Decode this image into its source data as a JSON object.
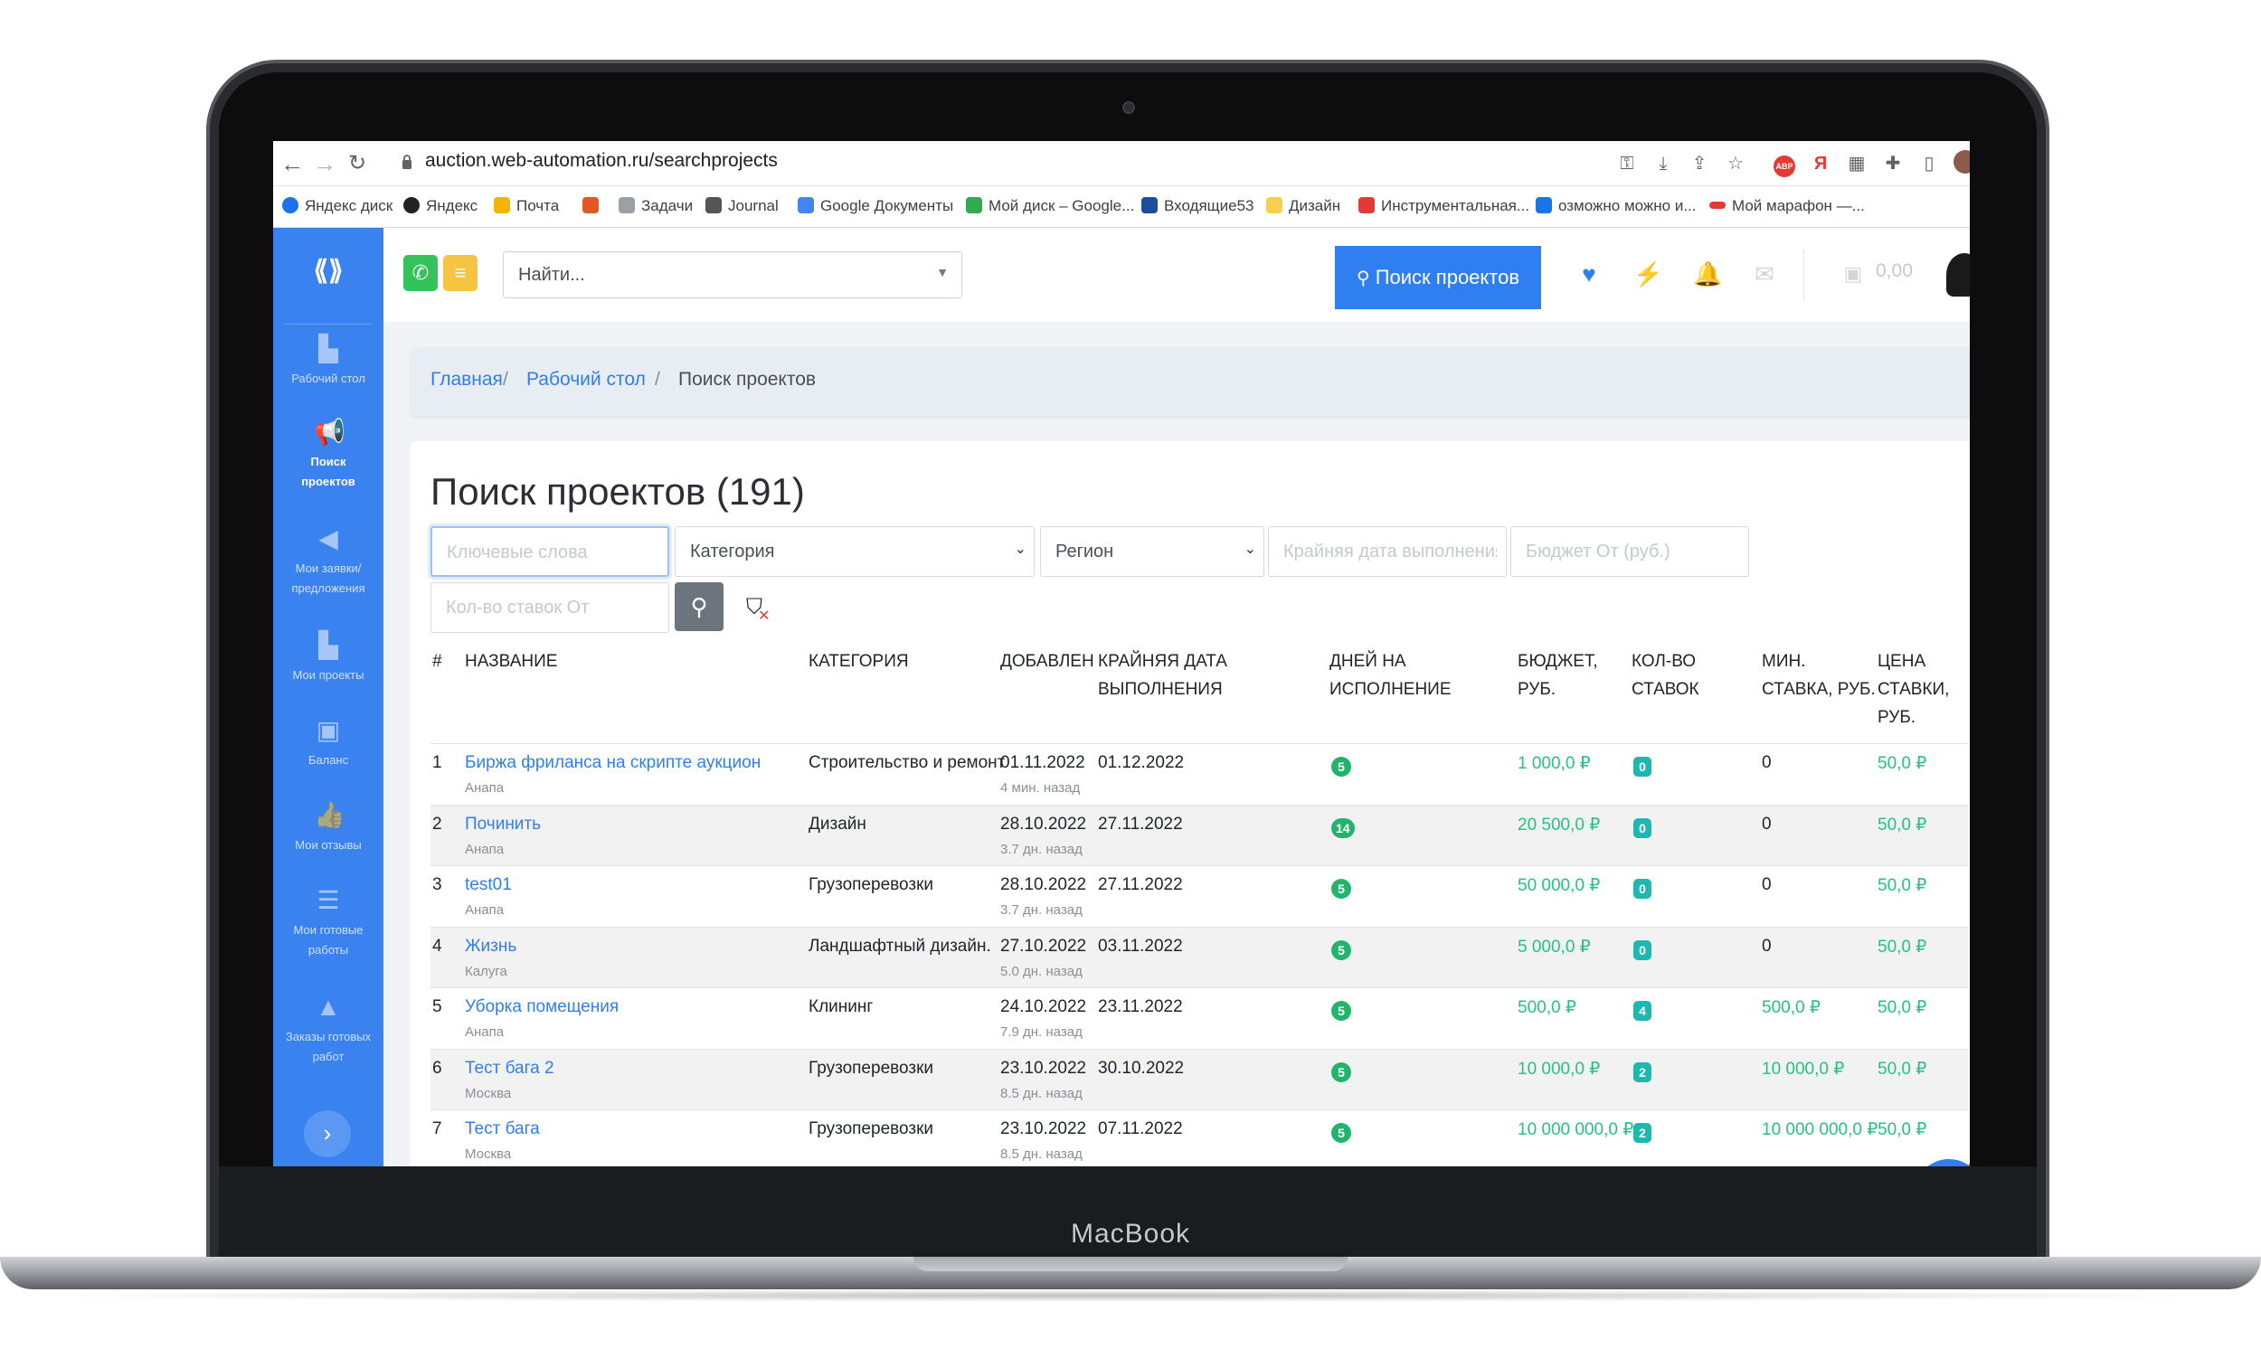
{
  "device": {
    "brand": "MacBook"
  },
  "browser": {
    "url": "auction.web-automation.ru/searchprojects",
    "bookmarks": [
      {
        "label": "Яндекс диск",
        "color": "#1a73e8"
      },
      {
        "label": "Яндекс",
        "color": "#222222"
      },
      {
        "label": "Почта",
        "color": "#f4b400"
      },
      {
        "label": "",
        "color": "#e25822"
      },
      {
        "label": "Задачи",
        "color": "#9aa0a6"
      },
      {
        "label": "Journal",
        "color": "#555555"
      },
      {
        "label": "Google Документы",
        "color": "#4285f4"
      },
      {
        "label": "Мой диск – Google...",
        "color": "#34a853"
      },
      {
        "label": "Входящие53",
        "color": "#1a4fa0"
      },
      {
        "label": "Дизайн",
        "color": "#f9cf52"
      },
      {
        "label": "Инструментальная...",
        "color": "#e53935"
      },
      {
        "label": "озможно можно и...",
        "color": "#1a73e8"
      },
      {
        "label": "Мой марафон —...",
        "color": "#e53935"
      }
    ]
  },
  "sidebar": {
    "items": [
      {
        "label": "Рабочий стол",
        "icon": "desk-icon"
      },
      {
        "label": "Поиск проектов",
        "icon": "megaphone-icon",
        "active": true
      },
      {
        "label": "Мои заявки/ предложения",
        "icon": "megaphone-outline-icon"
      },
      {
        "label": "Мои проекты",
        "icon": "projects-icon"
      },
      {
        "label": "Баланс",
        "icon": "money-icon"
      },
      {
        "label": "Мои отзывы",
        "icon": "thumbs-up-icon"
      },
      {
        "label": "Мои готовые работы",
        "icon": "menu-icon"
      },
      {
        "label": "Заказы готовых работ",
        "icon": "bag-icon"
      }
    ]
  },
  "topbar": {
    "find_placeholder": "Найти...",
    "search_projects_label": "Поиск проектов",
    "balance": "0,00"
  },
  "breadcrumb": {
    "home": "Главная",
    "desk": "Рабочий стол",
    "current": "Поиск проектов"
  },
  "page": {
    "title": "Поиск проектов (191)"
  },
  "filters": {
    "keywords_placeholder": "Ключевые слова",
    "category_value": "Категория",
    "region_value": "Регион",
    "deadline_placeholder": "Крайняя дата выполнения",
    "budget_placeholder": "Бюджет От (руб.)",
    "bids_placeholder": "Кол-во ставок От"
  },
  "table": {
    "headers": {
      "num": "#",
      "name": "НАЗВАНИЕ",
      "category": "КАТЕГОРИЯ",
      "added": "ДОБАВЛЕН",
      "deadline": "КРАЙНЯЯ ДАТА ВЫПОЛНЕНИЯ",
      "days": "ДНЕЙ НА ИСПОЛНЕНИЕ",
      "budget": "БЮДЖЕТ, РУБ.",
      "bids": "КОЛ-ВО СТАВОК",
      "min_bid": "МИН. СТАВКА, РУБ.",
      "bid_price": "ЦЕНА СТАВКИ, РУБ."
    },
    "rows": [
      {
        "num": "1",
        "name": "Биржа фриланса на скрипте аукцион",
        "city": "Анапа",
        "category": "Строительство и ремонт",
        "added": "01.11.2022",
        "ago": "4 мин. назад",
        "deadline": "01.12.2022",
        "days": "5",
        "budget": "1 000,0 ₽",
        "bids": "0",
        "min_bid": "0",
        "price": "50,0 ₽"
      },
      {
        "num": "2",
        "name": "Починить",
        "city": "Анапа",
        "category": "Дизайн",
        "added": "28.10.2022",
        "ago": "3.7 дн. назад",
        "deadline": "27.11.2022",
        "days": "14",
        "budget": "20 500,0 ₽",
        "bids": "0",
        "min_bid": "0",
        "price": "50,0 ₽"
      },
      {
        "num": "3",
        "name": "test01",
        "city": "Анапа",
        "category": "Грузоперевозки",
        "added": "28.10.2022",
        "ago": "3.7 дн. назад",
        "deadline": "27.11.2022",
        "days": "5",
        "budget": "50 000,0 ₽",
        "bids": "0",
        "min_bid": "0",
        "price": "50,0 ₽"
      },
      {
        "num": "4",
        "name": "Жизнь",
        "city": "Калуга",
        "category": "Ландшафтный дизайн.",
        "added": "27.10.2022",
        "ago": "5.0 дн. назад",
        "deadline": "03.11.2022",
        "days": "5",
        "budget": "5 000,0 ₽",
        "bids": "0",
        "min_bid": "0",
        "price": "50,0 ₽"
      },
      {
        "num": "5",
        "name": "Уборка помещения",
        "city": "Анапа",
        "category": "Клининг",
        "added": "24.10.2022",
        "ago": "7.9 дн. назад",
        "deadline": "23.11.2022",
        "days": "5",
        "budget": "500,0 ₽",
        "bids": "4",
        "min_bid": "500,0 ₽",
        "price": "50,0 ₽"
      },
      {
        "num": "6",
        "name": "Тест бага 2",
        "city": "Москва",
        "category": "Грузоперевозки",
        "added": "23.10.2022",
        "ago": "8.5 дн. назад",
        "deadline": "30.10.2022",
        "days": "5",
        "budget": "10 000,0 ₽",
        "bids": "2",
        "min_bid": "10 000,0 ₽",
        "price": "50,0 ₽"
      },
      {
        "num": "7",
        "name": "Тест бага",
        "city": "Москва",
        "category": "Грузоперевозки",
        "added": "23.10.2022",
        "ago": "8.5 дн. назад",
        "deadline": "07.11.2022",
        "days": "5",
        "budget": "10 000 000,0 ₽",
        "bids": "2",
        "min_bid": "10 000 000,0 ₽",
        "price": "50,0 ₽"
      }
    ]
  },
  "colors": {
    "accent": "#2f7ff0",
    "sidebar": "#3a82f0",
    "green": "#26c281"
  }
}
